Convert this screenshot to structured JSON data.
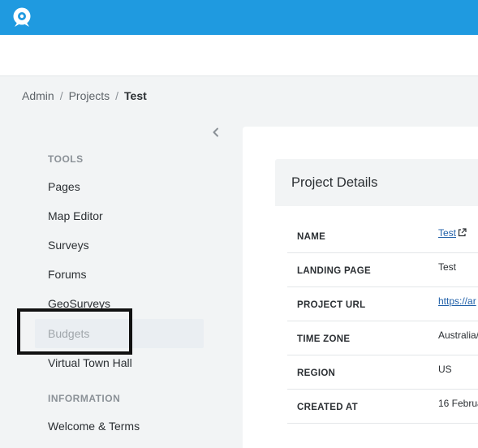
{
  "breadcrumb": {
    "items": [
      "Admin",
      "Projects"
    ],
    "current": "Test",
    "separator": "/"
  },
  "sidebar": {
    "tools_heading": "TOOLS",
    "tools": [
      {
        "label": "Pages"
      },
      {
        "label": "Map Editor"
      },
      {
        "label": "Surveys"
      },
      {
        "label": "Forums"
      },
      {
        "label": "GeoSurveys"
      },
      {
        "label": "Budgets",
        "selected": true
      },
      {
        "label": "Virtual Town Hall"
      }
    ],
    "information_heading": "INFORMATION",
    "information": [
      {
        "label": "Welcome & Terms"
      }
    ]
  },
  "details": {
    "title": "Project Details",
    "rows": [
      {
        "label": "NAME",
        "value": "Test"
      },
      {
        "label": "LANDING PAGE",
        "value": "Test"
      },
      {
        "label": "PROJECT URL",
        "value": "https://ar"
      },
      {
        "label": "TIME ZONE",
        "value": "Australia/"
      },
      {
        "label": "REGION",
        "value": "US"
      },
      {
        "label": "CREATED AT",
        "value": "16 Februa"
      }
    ]
  },
  "colors": {
    "topbar": "#1f9ae0",
    "link": "#1f5fa8",
    "page_bg": "#f2f4f5"
  },
  "icons": {
    "logo": "speech-bubble-logo-icon",
    "collapse": "chevron-left-icon",
    "external": "external-link-icon"
  }
}
